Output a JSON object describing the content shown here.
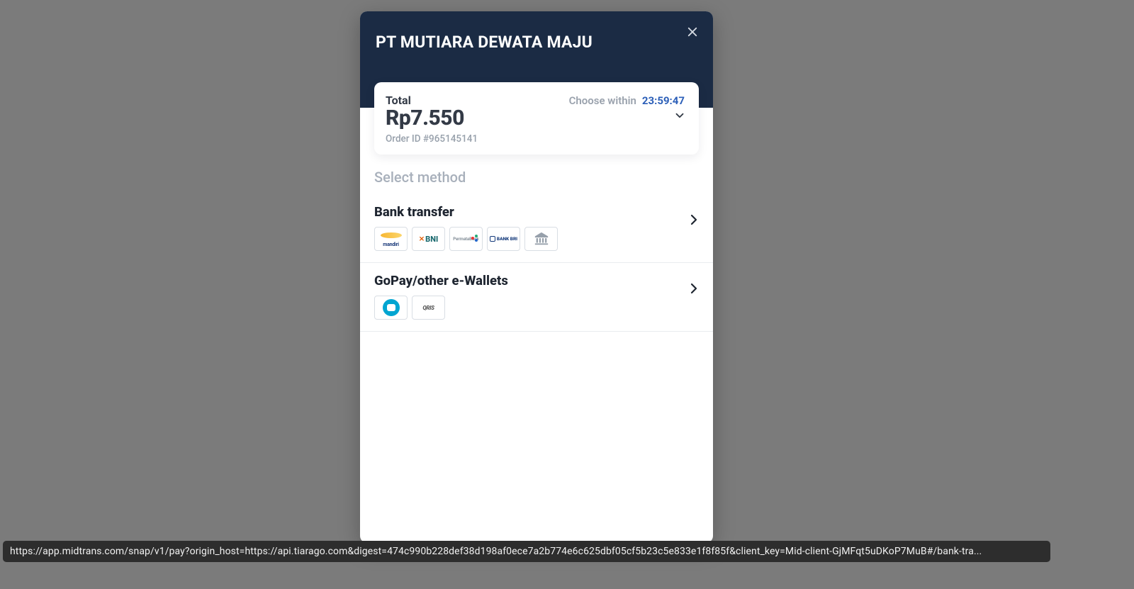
{
  "merchant_name": "PT MUTIARA DEWATA MAJU",
  "summary": {
    "total_label": "Total",
    "amount": "Rp7.550",
    "choose_label": "Choose within",
    "timer": "23:59:47",
    "order_id_label": "Order ID #965145141"
  },
  "section_title": "Select method",
  "methods": [
    {
      "title": "Bank transfer",
      "logos": [
        "mandiri",
        "BNI",
        "PermataBank",
        "BANK BRI",
        "bank-generic"
      ]
    },
    {
      "title": "GoPay/other e-Wallets",
      "logos": [
        "GoPay",
        "QRIS"
      ]
    }
  ],
  "url_preview": "https://app.midtrans.com/snap/v1/pay?origin_host=https://api.tiarago.com&digest=474c990b228def38d198af0ece7a2b774e6c625dbf05cf5b23c5e833e1f8f85f&client_key=Mid-client-GjMFqt5uDKoP7MuB#/bank-tra..."
}
